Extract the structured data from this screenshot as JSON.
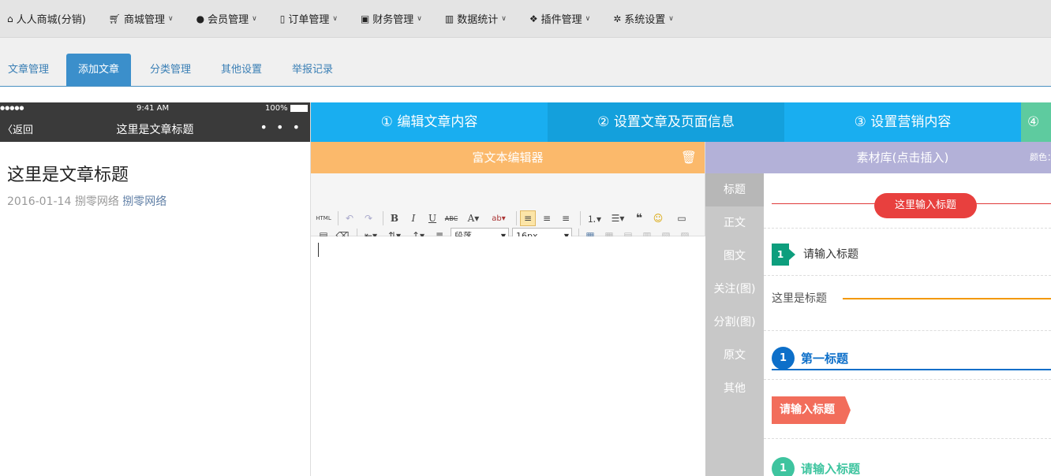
{
  "topnav": {
    "items": [
      {
        "label": "人人商城(分销)",
        "icon": "home-icon",
        "caret": false
      },
      {
        "label": "商城管理",
        "icon": "cart-icon",
        "caret": true
      },
      {
        "label": "会员管理",
        "icon": "user-icon",
        "caret": true
      },
      {
        "label": "订单管理",
        "icon": "file-icon",
        "caret": true
      },
      {
        "label": "财务管理",
        "icon": "money-icon",
        "caret": true
      },
      {
        "label": "数据统计",
        "icon": "bar-chart-icon",
        "caret": true
      },
      {
        "label": "插件管理",
        "icon": "cubes-icon",
        "caret": true
      },
      {
        "label": "系统设置",
        "icon": "gear-icon",
        "caret": true
      }
    ]
  },
  "subtabs": [
    {
      "label": "文章管理",
      "active": false
    },
    {
      "label": "添加文章",
      "active": true
    },
    {
      "label": "分类管理",
      "active": false
    },
    {
      "label": "其他设置",
      "active": false
    },
    {
      "label": "举报记录",
      "active": false
    }
  ],
  "phone": {
    "signal": "●●●●● ",
    "time": "9:41 AM",
    "battery": "100%",
    "back_label": "返回",
    "header_title": "这里是文章标题",
    "more": "• • •",
    "article_title": "这里是文章标题",
    "date": "2016-01-14",
    "author": "捌零网络",
    "author_link": "捌零网络"
  },
  "steps": [
    {
      "label": "① 编辑文章内容",
      "color": "#1aa7ec"
    },
    {
      "label": "② 设置文章及页面信息",
      "color": "#1d9ad9"
    },
    {
      "label": "③ 设置营销内容",
      "color": "#1aa7ec"
    },
    {
      "label": "④",
      "color": "#5ecb9f"
    }
  ],
  "editor": {
    "title": "富文本编辑器",
    "paragraph_select": "段落",
    "fontsize_select": "16px"
  },
  "material": {
    "title": "素材库(点击插入)",
    "color_label": "颜色：",
    "categories": [
      {
        "label": "标题",
        "active": true
      },
      {
        "label": "正文",
        "active": false
      },
      {
        "label": "图文",
        "active": false
      },
      {
        "label": "关注(图)",
        "active": false
      },
      {
        "label": "分割(图)",
        "active": false
      },
      {
        "label": "原文",
        "active": false
      },
      {
        "label": "其他",
        "active": false
      }
    ],
    "samples": {
      "s1": "这里输入标题",
      "s2_num": "1",
      "s2": "请输入标题",
      "s3": "这里是标题",
      "s4_num": "1",
      "s4": "第一标题",
      "s5": "请输入标题",
      "s6_num": "1",
      "s6": "请输入标题"
    }
  }
}
